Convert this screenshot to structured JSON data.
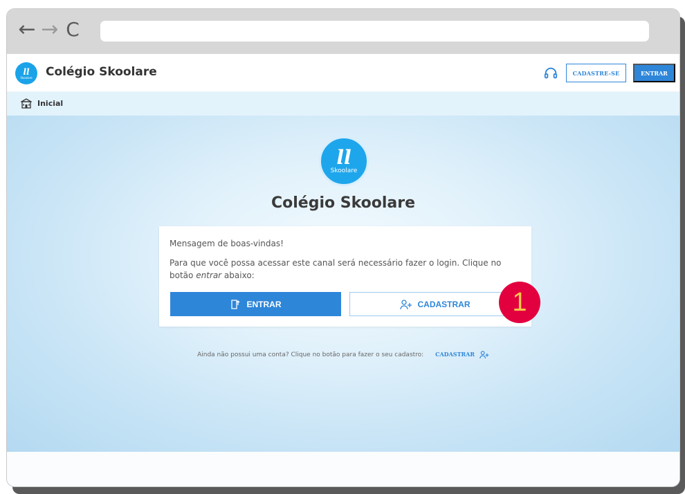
{
  "browser": {
    "back": "←",
    "forward": "→",
    "reload": "C",
    "url": ""
  },
  "header": {
    "logo_mark": "ll",
    "logo_brand": "Skoolare",
    "title": "Colégio Skoolare",
    "cadastre_se_label": "CADASTRE-SE",
    "entrar_label": "ENTRAR"
  },
  "breadcrumb": {
    "label": "Inicial"
  },
  "hero": {
    "logo_mark": "ll",
    "logo_brand": "Skoolare",
    "title": "Colégio Skoolare"
  },
  "card": {
    "welcome": "Mensagem de boas-vindas!",
    "text_before": "Para que você possa acessar este canal será necessário fazer o login. Clique no botão ",
    "text_em": "entrar",
    "text_after": " abaixo:",
    "entrar_label": "ENTRAR",
    "cadastrar_label": "CADASTRAR"
  },
  "callout": {
    "number": "1"
  },
  "footer": {
    "hint": "Ainda não possui uma conta? Clique no botão para fazer o seu cadastro:",
    "link_label": "CADASTRAR"
  },
  "colors": {
    "primary": "#2e86d9",
    "logo": "#1ea6ec",
    "callout_bg": "#e3003f",
    "callout_text": "#f7c84a"
  },
  "icons": {
    "support": "headset-icon",
    "home": "school-building-icon",
    "entrar": "login-door-icon",
    "cadastrar": "add-user-icon"
  }
}
